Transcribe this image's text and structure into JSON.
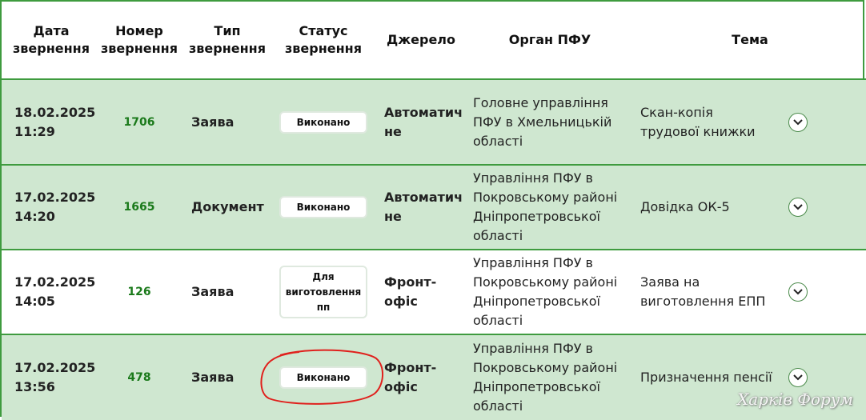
{
  "columns": {
    "date": "Дата звернення",
    "number": "Номер звернення",
    "type": "Тип звернення",
    "status": "Статус звернення",
    "source": "Джерело",
    "organ": "Орган ПФУ",
    "topic": "Тема"
  },
  "rows": [
    {
      "date": "18.02.2025",
      "time": "11:29",
      "number": "1706",
      "type": "Заява",
      "status": "Виконано",
      "source_line1": "Автоматич",
      "source_line2": "не",
      "organ_line1": "Головне управління",
      "organ_line2": "ПФУ в Хмельницькій",
      "organ_line3": "області",
      "organ_line4": "",
      "topic_line1": "Скан-копія",
      "topic_line2": "трудової книжки"
    },
    {
      "date": "17.02.2025",
      "time": "14:20",
      "number": "1665",
      "type": "Документ",
      "status": "Виконано",
      "source_line1": "Автоматич",
      "source_line2": "не",
      "organ_line1": "Управління ПФУ в",
      "organ_line2": "Покровському районі",
      "organ_line3": "Дніпропетровської",
      "organ_line4": "області",
      "topic_line1": "Довідка ОК-5",
      "topic_line2": ""
    },
    {
      "date": "17.02.2025",
      "time": "14:05",
      "number": "126",
      "type": "Заява",
      "status_line1": "Для",
      "status_line2": "виготовлення",
      "status_line3": "пп",
      "source_line1": "Фронт-",
      "source_line2": "офіс",
      "organ_line1": "Управління ПФУ в",
      "organ_line2": "Покровському районі",
      "organ_line3": "Дніпропетровської",
      "organ_line4": "області",
      "topic_line1": "Заява на",
      "topic_line2": "виготовлення ЕПП"
    },
    {
      "date": "17.02.2025",
      "time": "13:56",
      "number": "478",
      "type": "Заява",
      "status": "Виконано",
      "source_line1": "Фронт-",
      "source_line2": "офіс",
      "organ_line1": "Управління ПФУ в",
      "organ_line2": "Покровському районі",
      "organ_line3": "Дніпропетровської",
      "organ_line4": "області",
      "topic_line1": "Призначення пенсії",
      "topic_line2": ""
    }
  ],
  "watermark": "Харків Форум",
  "colors": {
    "accent_green": "#3f9b3f",
    "row_green": "#cfe7d0",
    "number_green": "#1b7a1b",
    "annotation_red": "#e0201c"
  },
  "icons": {
    "expand": "chevron-down-icon"
  }
}
